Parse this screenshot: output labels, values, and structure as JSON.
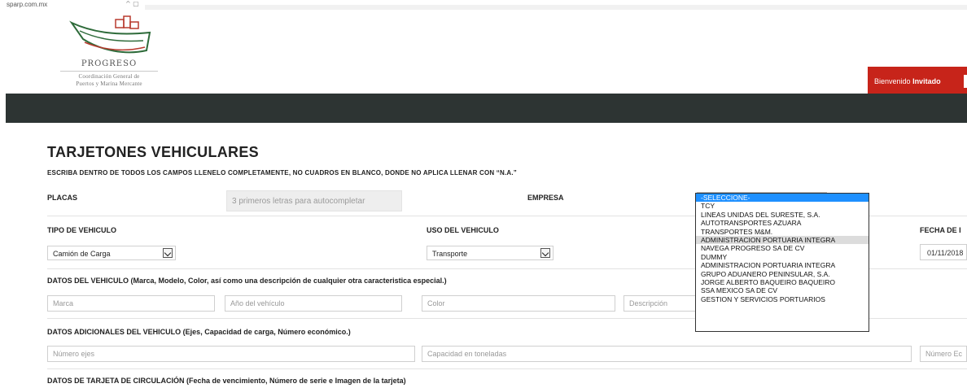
{
  "browser": {
    "url": "sparp.com.mx",
    "controls": "^ ▢"
  },
  "logo": {
    "name": "PROGRESO",
    "subtitle_1": "Coordinación General de",
    "subtitle_2": "Puertos y Marina Mercante"
  },
  "welcome": {
    "prefix": "Bienvenido",
    "user": "Invitado"
  },
  "page_title": "TARJETONES VEHICULARES",
  "instructions": "ESCRIBA DENTRO DE TODOS LOS CAMPOS LLENELO COMPLETAMENTE, NO CUADROS EN BLANCO, DONDE NO APLICA LLENAR CON “N.A.”",
  "placas": {
    "label": "PLACAS",
    "placeholder": "3 primeros letras para autocompletar"
  },
  "empresa": {
    "label": "EMPRESA",
    "options": [
      "-SELECCIONE-",
      "TCY",
      "LINEAS UNIDAS DEL SURESTE, S.A.",
      "AUTOTRANSPORTES AZUARA",
      "TRANSPORTES M&M.",
      "ADMINISTRACION PORTUARIA INTEGRA",
      "NAVEGA PROGRESO SA DE CV",
      "DUMMY",
      "ADMINISTRACION PORTUARIA INTEGRA",
      "GRUPO ADUANERO PENINSULAR, S.A.",
      "JORGE ALBERTO BAQUEIRO BAQUEIRO",
      "SSA MEXICO SA DE CV",
      "GESTION Y SERVICIOS PORTUARIOS"
    ]
  },
  "tipo_vehiculo": {
    "label": "TIPO DE VEHICULO",
    "value": "Camión de Carga"
  },
  "uso_vehiculo": {
    "label": "USO DEL VEHICULO",
    "value": "Transporte"
  },
  "fecha": {
    "label": "FECHA DE I",
    "value": "01/11/2018"
  },
  "datos_vehiculo": {
    "label": "DATOS DEL VEHICULO (Marca, Modelo, Color, así como una descripción de cualquier otra caracteristica especial.)",
    "marca": "Marca",
    "anio": "Año del vehículo",
    "color": "Color",
    "descripcion": "Descripción"
  },
  "datos_adicionales": {
    "label": "DATOS ADICIONALES DEL VEHICULO (Ejes, Capacidad de carga, Número económico.)",
    "ejes": "Número ejes",
    "capacidad": "Capacidad en toneladas",
    "economico": "Número Ec"
  },
  "tarjeta_circulacion": {
    "label": "DATOS DE TARJETA DE CIRCULACIÓN (Fecha de vencimiento, Número de serie e Imagen de la tarjeta)"
  },
  "colors": {
    "welcome_bg": "#c7241a",
    "navbar_bg": "#2d3433",
    "selected_option": "#1e90ff"
  }
}
